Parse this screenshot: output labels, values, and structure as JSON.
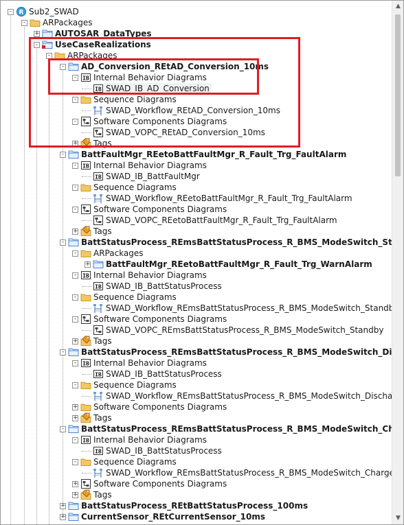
{
  "tree": {
    "nodes": [
      {
        "label": "Sub2_SWAD",
        "icon": "project-icon",
        "expander": "-",
        "bold": false
      },
      {
        "label": "ARPackages",
        "icon": "folder-icon",
        "expander": "-",
        "bold": false
      },
      {
        "label": "AUTOSAR_DataTypes",
        "icon": "package-icon",
        "expander": "+",
        "bold": true
      },
      {
        "label": "UseCaseRealizations",
        "icon": "package-red-icon",
        "expander": "-",
        "bold": true
      },
      {
        "label": "ARPackages",
        "icon": "folder-icon",
        "expander": "-",
        "bold": false
      },
      {
        "label": "AD_Conversion_REtAD_Conversion_10ms",
        "icon": "package-icon",
        "expander": "-",
        "bold": true
      },
      {
        "label": "Internal Behavior Diagrams",
        "icon": "ib-icon",
        "expander": "-",
        "bold": false
      },
      {
        "label": "SWAD_IB_AD_Conversion",
        "icon": "ib-icon",
        "expander": "",
        "bold": false
      },
      {
        "label": "Sequence Diagrams",
        "icon": "folder-icon",
        "expander": "-",
        "bold": false
      },
      {
        "label": "SWAD_Workflow_REtAD_Conversion_10ms",
        "icon": "sequence-diagram-icon",
        "expander": "",
        "bold": false
      },
      {
        "label": "Software Components Diagrams",
        "icon": "component-diagram-icon",
        "expander": "-",
        "bold": false
      },
      {
        "label": "SWAD_VOPC_REtAD_Conversion_10ms",
        "icon": "component-diagram-icon",
        "expander": "",
        "bold": false
      },
      {
        "label": "Tags",
        "icon": "tags-icon",
        "expander": "+",
        "bold": false
      },
      {
        "label": "BattFaultMgr_REetoBattFaultMgr_R_Fault_Trg_FaultAlarm",
        "icon": "package-icon",
        "expander": "-",
        "bold": true
      },
      {
        "label": "Internal Behavior Diagrams",
        "icon": "ib-icon",
        "expander": "-",
        "bold": false
      },
      {
        "label": "SWAD_IB_BattFaultMgr",
        "icon": "ib-icon",
        "expander": "",
        "bold": false
      },
      {
        "label": "Sequence Diagrams",
        "icon": "folder-icon",
        "expander": "-",
        "bold": false
      },
      {
        "label": "SWAD_Workflow_REetoBattFaultMgr_R_Fault_Trg_FaultAlarm",
        "icon": "sequence-diagram-icon",
        "expander": "",
        "bold": false
      },
      {
        "label": "Software Components Diagrams",
        "icon": "component-diagram-icon",
        "expander": "-",
        "bold": false
      },
      {
        "label": "SWAD_VOPC_REetoBattFaultMgr_R_Fault_Trg_FaultAlarm",
        "icon": "component-diagram-icon",
        "expander": "",
        "bold": false
      },
      {
        "label": "Tags",
        "icon": "tags-icon",
        "expander": "+",
        "bold": false
      },
      {
        "label": "BattStatusProcess_REmsBattStatusProcess_R_BMS_ModeSwitch_Standby",
        "icon": "package-icon",
        "expander": "-",
        "bold": true
      },
      {
        "label": "ARPackages",
        "icon": "folder-icon",
        "expander": "-",
        "bold": false
      },
      {
        "label": "BattFaultMgr_REetoBattFaultMgr_R_Fault_Trg_WarnAlarm",
        "icon": "package-icon",
        "expander": "+",
        "bold": true
      },
      {
        "label": "Internal Behavior Diagrams",
        "icon": "ib-icon",
        "expander": "-",
        "bold": false
      },
      {
        "label": "SWAD_IB_BattStatusProcess",
        "icon": "ib-icon",
        "expander": "",
        "bold": false
      },
      {
        "label": "Sequence Diagrams",
        "icon": "folder-icon",
        "expander": "-",
        "bold": false
      },
      {
        "label": "SWAD_Workflow_REmsBattStatusProcess_R_BMS_ModeSwitch_Standby",
        "icon": "sequence-diagram-icon",
        "expander": "",
        "bold": false
      },
      {
        "label": "Software Components Diagrams",
        "icon": "component-diagram-icon",
        "expander": "-",
        "bold": false
      },
      {
        "label": "SWAD_VOPC_REmsBattStatusProcess_R_BMS_ModeSwitch_Standby",
        "icon": "component-diagram-icon",
        "expander": "",
        "bold": false
      },
      {
        "label": "Tags",
        "icon": "tags-icon",
        "expander": "+",
        "bold": false
      },
      {
        "label": "BattStatusProcess_REmsBattStatusProcess_R_BMS_ModeSwitch_Discharge",
        "icon": "package-icon",
        "expander": "-",
        "bold": true
      },
      {
        "label": "Internal Behavior Diagrams",
        "icon": "ib-icon",
        "expander": "-",
        "bold": false
      },
      {
        "label": "SWAD_IB_BattStatusProcess",
        "icon": "ib-icon",
        "expander": "",
        "bold": false
      },
      {
        "label": "Sequence Diagrams",
        "icon": "folder-icon",
        "expander": "-",
        "bold": false
      },
      {
        "label": "SWAD_Workflow_REmsBattStatusProcess_R_BMS_ModeSwitch_Discharge",
        "icon": "sequence-diagram-icon",
        "expander": "",
        "bold": false
      },
      {
        "label": "Software Components Diagrams",
        "icon": "folder-icon",
        "expander": "+",
        "bold": false
      },
      {
        "label": "Tags",
        "icon": "tags-icon",
        "expander": "+",
        "bold": false
      },
      {
        "label": "BattStatusProcess_REmsBattStatusProcess_R_BMS_ModeSwitch_Charge",
        "icon": "package-icon",
        "expander": "-",
        "bold": true
      },
      {
        "label": "Internal Behavior Diagrams",
        "icon": "ib-icon",
        "expander": "-",
        "bold": false
      },
      {
        "label": "SWAD_IB_BattStatusProcess",
        "icon": "ib-icon",
        "expander": "",
        "bold": false
      },
      {
        "label": "Sequence Diagrams",
        "icon": "folder-icon",
        "expander": "-",
        "bold": false
      },
      {
        "label": "SWAD_Workflow_REmsBattStatusProcess_R_BMS_ModeSwitch_Charge",
        "icon": "sequence-diagram-icon",
        "expander": "",
        "bold": false
      },
      {
        "label": "Software Components Diagrams",
        "icon": "component-diagram-icon",
        "expander": "+",
        "bold": false
      },
      {
        "label": "Tags",
        "icon": "tags-icon",
        "expander": "+",
        "bold": false
      },
      {
        "label": "BattStatusProcess_REtBattStatusProcess_100ms",
        "icon": "package-icon",
        "expander": "+",
        "bold": true
      },
      {
        "label": "CurrentSensor_REtCurrentSensor_10ms",
        "icon": "package-icon",
        "expander": "+",
        "bold": true
      }
    ],
    "selected_label": "SWAD_IB_AD_Conversion"
  },
  "colors": {
    "highlight_box": "#e21b23",
    "folder": "#f2c866",
    "package": "#4a86d6",
    "project": "#3aa0dc"
  }
}
